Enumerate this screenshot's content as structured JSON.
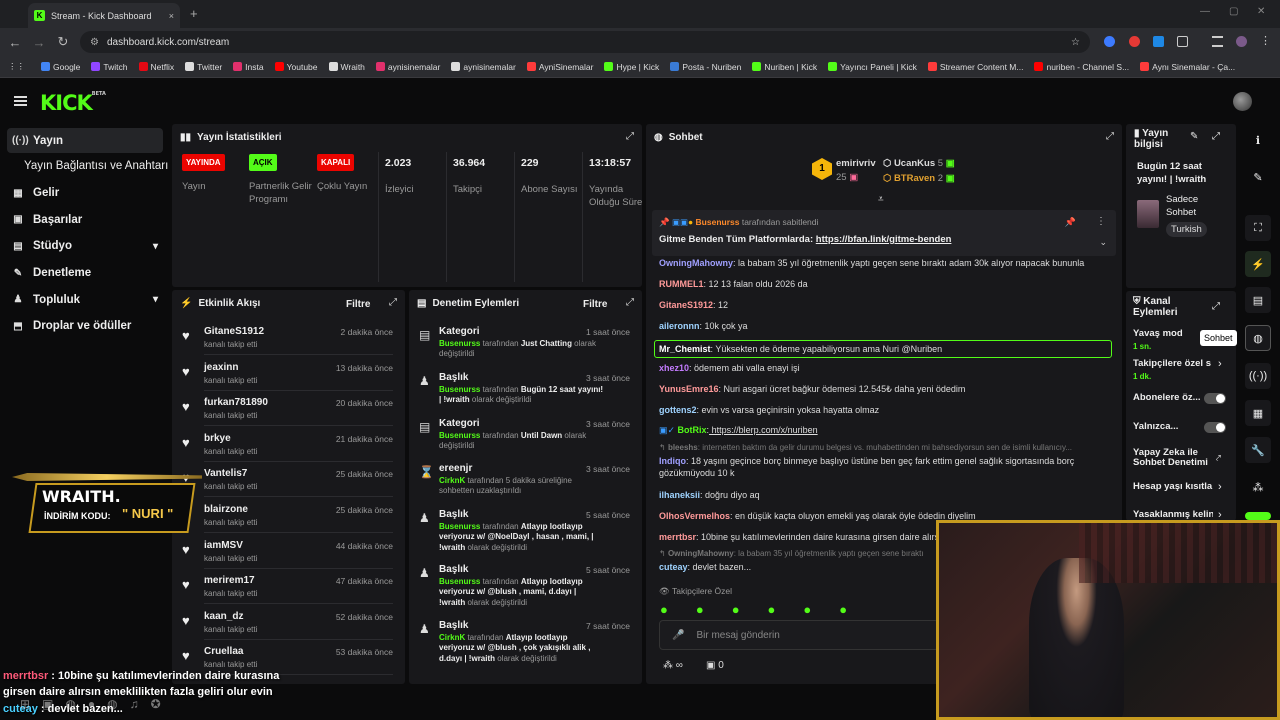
{
  "browser": {
    "tab_title": "Stream - Kick Dashboard",
    "tab_close": "×",
    "new_tab": "+",
    "url": "dashboard.kick.com/stream",
    "bookmarks": [
      "Google",
      "Twitch",
      "Netflix",
      "Twitter",
      "Insta",
      "Youtube",
      "Wraith",
      "aynisinemalar",
      "aynisinemalar",
      "AyniSinemalar",
      "Hype | Kick",
      "Posta - Nuriben",
      "Nuriben | Kick",
      "Yayıncı Paneli | Kick",
      "Streamer Content M...",
      "nuriben - Channel S...",
      "Aynı Sinemalar - Ça..."
    ]
  },
  "kick": {
    "logo": "KICK",
    "logo_beta": "BETA"
  },
  "sidebar": {
    "items": [
      {
        "label": "Yayın",
        "icon": "stream-icon"
      },
      {
        "label": "Yayın Bağlantısı ve Anahtarı"
      },
      {
        "label": "Gelir",
        "icon": "revenue-icon"
      },
      {
        "label": "Başarılar",
        "icon": "achievements-icon"
      },
      {
        "label": "Stüdyo",
        "icon": "studio-icon"
      },
      {
        "label": "Denetleme",
        "icon": "moderation-icon"
      },
      {
        "label": "Topluluk",
        "icon": "community-icon"
      },
      {
        "label": "Droplar ve ödüller",
        "icon": "drops-icon"
      }
    ]
  },
  "stats": {
    "title": "Yayın İstatistikleri",
    "items": [
      {
        "badge": "YAYINDA",
        "label": "Yayın",
        "color": "#eb0400"
      },
      {
        "badge": "AÇIK",
        "label": "Partnerlik Gelir Programı",
        "color": "#53fc18"
      },
      {
        "badge": "KAPALI",
        "label": "Çoklu Yayın",
        "color": "#eb0400"
      },
      {
        "value": "2.023",
        "label": "İzleyici"
      },
      {
        "value": "36.964",
        "label": "Takipçi"
      },
      {
        "value": "229",
        "label": "Abone Sayısı"
      },
      {
        "value": "13:18:57",
        "label": "Yayında Olduğu Süre"
      }
    ]
  },
  "activity": {
    "title": "Etkinlik Akışı",
    "filter": "Filtre",
    "items": [
      {
        "name": "GitaneS1912",
        "sub": "kanalı takip etti",
        "time": "2 dakika önce"
      },
      {
        "name": "jeaxinn",
        "sub": "kanalı takip etti",
        "time": "13 dakika önce"
      },
      {
        "name": "furkan781890",
        "sub": "kanalı takip etti",
        "time": "20 dakika önce"
      },
      {
        "name": "brkye",
        "sub": "kanalı takip etti",
        "time": "21 dakika önce"
      },
      {
        "name": "Vantelis7",
        "sub": "kanalı takip etti",
        "time": "25 dakika önce"
      },
      {
        "name": "blairzone",
        "sub": "kanalı takip etti",
        "time": "25 dakika önce"
      },
      {
        "name": "iamMSV",
        "sub": "kanalı takip etti",
        "time": "44 dakika önce"
      },
      {
        "name": "merirem17",
        "sub": "kanalı takip etti",
        "time": "47 dakika önce"
      },
      {
        "name": "kaan_dz",
        "sub": "kanalı takip etti",
        "time": "52 dakika önce"
      },
      {
        "name": "Cruellaa",
        "sub": "kanalı takip etti",
        "time": "53 dakika önce"
      }
    ]
  },
  "moderation": {
    "title": "Denetim Eylemleri",
    "filter": "Filtre",
    "items": [
      {
        "title": "Kategori",
        "time": "1 saat önce",
        "actor": "Busenurss",
        "mid": " tarafından ",
        "hl": "Just Chatting",
        "end": " olarak değiştirildi"
      },
      {
        "title": "Başlık",
        "time": "3 saat önce",
        "actor": "Busenurss",
        "mid": " tarafından ",
        "hl": "Bugün 12 saat yayını! | !wraith",
        "end": " olarak değiştirildi"
      },
      {
        "title": "Kategori",
        "time": "3 saat önce",
        "actor": "Busenurss",
        "mid": " tarafından ",
        "hl": "Until Dawn",
        "end": " olarak değiştirildi"
      },
      {
        "title": "ereenjr",
        "time": "3 saat önce",
        "actor": "CirknK",
        "mid": " tarafından 5 dakika süreliğine sohbetten uzaklaştırıldı",
        "hl": "",
        "end": ""
      },
      {
        "title": "Başlık",
        "time": "5 saat önce",
        "actor": "Busenurss",
        "mid": " tarafından ",
        "hl": "Atlayıp lootlayıp veriyoruz w/ @NoelDayl , hasan , mami, | !wraith",
        "end": " olarak değiştirildi"
      },
      {
        "title": "Başlık",
        "time": "5 saat önce",
        "actor": "Busenurss",
        "mid": " tarafından ",
        "hl": "Atlayıp lootlayıp veriyoruz w/ @blush , mami, d.dayı | !wraith",
        "end": " olarak değiştirildi"
      },
      {
        "title": "Başlık",
        "time": "7 saat önce",
        "actor": "CirknK",
        "mid": " tarafından ",
        "hl": "Atlayıp lootlayıp veriyoruz w/ @blush , çok yakışıklı alik , d.dayı | !wraith",
        "end": " olarak değiştirildi"
      }
    ]
  },
  "chat": {
    "title": "Sohbet",
    "leaders": [
      {
        "rank": "1",
        "name": "emirivriv",
        "count": "25"
      },
      {
        "name": "UcanKus",
        "count": "5"
      },
      {
        "name": "BTRaven",
        "count": "2"
      }
    ],
    "pinned_by": "Busenurss",
    "pinned_suffix": " tarafından sabitlendi",
    "pinned_text": "Gitme Benden Tüm Platformlarda: ",
    "pinned_link": "https://bfan.link/gitme-benden",
    "messages": [
      {
        "user": "OwningMahowny",
        "color": "#a0a0ff",
        "text": " la babam 35 yıl öğretmenlik yaptı geçen sene bıraktı adam 30k alıyor napacak bununla"
      },
      {
        "user": "RUMMEL1",
        "color": "#ff9a9a",
        "text": " 12 13 falan oldu 2026 da"
      },
      {
        "user": "GitaneS1912",
        "color": "#ff9a9a",
        "text": " 12"
      },
      {
        "user": "aileronnn",
        "color": "#9fd3ff",
        "text": " 10k çok ya"
      },
      {
        "user": "Mr_Chemist",
        "color": "#ffffff",
        "text": " Yüksekten de ödeme yapabiliyorsun ama Nuri @Nuriben"
      },
      {
        "user": "xhez10",
        "color": "#c47cff",
        "text": " ödemem abi valla enayi işi"
      },
      {
        "user": "YunusEmre16",
        "color": "#ff9a9a",
        "text": " Nuri asgari ücret bağkur ödemesi 12.545₺ daha yeni ödedim"
      },
      {
        "user": "gottens2",
        "color": "#9fd3ff",
        "text": " evin vs varsa geçinirsin yoksa hayatta olmaz"
      },
      {
        "user": "BotRix",
        "color": "#53fc18",
        "text": " https://blerp.com/x/nuriben"
      },
      {
        "user": "bleeshs",
        "color": "#777777",
        "text": " internetten baktım da gelir durumu belgesi vs. muhabettinden mi bahsediyorsun sen de isimli kullanıcıy..."
      },
      {
        "user": "Indiqo",
        "color": "#a0a0ff",
        "text": " 18 yaşını geçince borç binmeye başlıyo üstüne ben geç fark ettim genel sağlık sigortasında borç gözükmüyodu 10 k"
      },
      {
        "user": "ilhaneksii",
        "color": "#9fd3ff",
        "text": " doğru diyo aq"
      },
      {
        "user": "OlhosVermelhos",
        "color": "#ff9a9a",
        "text": " en düşük kaçta oluyon emekli yaş olarak öyle ödedin diyelim"
      },
      {
        "user": "merrtbsr",
        "color": "#ff9a9a",
        "text": " 10bine şu katılımevlerinden daire kurasına girsen daire alırsın"
      },
      {
        "user": "OwningMahowny",
        "color": "#777777",
        "text": " la babam 35 yıl öğretmenlik yaptı geçen sene bıraktı"
      },
      {
        "user": "cuteay",
        "color": "#9fd3ff",
        "text": " devlet bazen..."
      }
    ],
    "followers_only": "Takipçilere Özel",
    "input_placeholder": "Bir mesaj gönderin",
    "points": "0"
  },
  "stream_info": {
    "title": "Yayın bilgisi",
    "stream_title": "Bugün 12 saat yayını! | !wraith",
    "mode": "Sadece Sohbet",
    "language": "Turkish"
  },
  "channel_actions": {
    "title": "Kanal Eylemleri",
    "items": [
      {
        "label": "Yavaş mod",
        "sub": "1 sn."
      },
      {
        "label": "Takipçilere özel s",
        "sub": "1 dk."
      },
      {
        "label": "Abonelere öz..."
      },
      {
        "label": "Yalnızca..."
      },
      {
        "label": "Yapay Zeka ile Sohbet Denetimi"
      },
      {
        "label": "Hesap yaşı kısıtla"
      },
      {
        "label": "Yasaklanmış kelin"
      }
    ]
  },
  "tooltip": "Sohbet",
  "overlay": {
    "brand": "WRAITH.",
    "code_label": "İNDİRİM KODU:",
    "code": "\" NURI \"",
    "chat1_user": "merrtbsr",
    "chat1_text": " : 10bine şu katılımevlerinden daire kurasına",
    "chat2": "girsen daire alırsın emeklilikten fazla geliri olur evin",
    "chat3_user": "cuteay",
    "chat3_text": " : devlet bazen..."
  },
  "colors": {
    "kick_green": "#53fc18",
    "live_red": "#eb0400",
    "panel": "#18181b",
    "bg": "#0b0b0c"
  }
}
